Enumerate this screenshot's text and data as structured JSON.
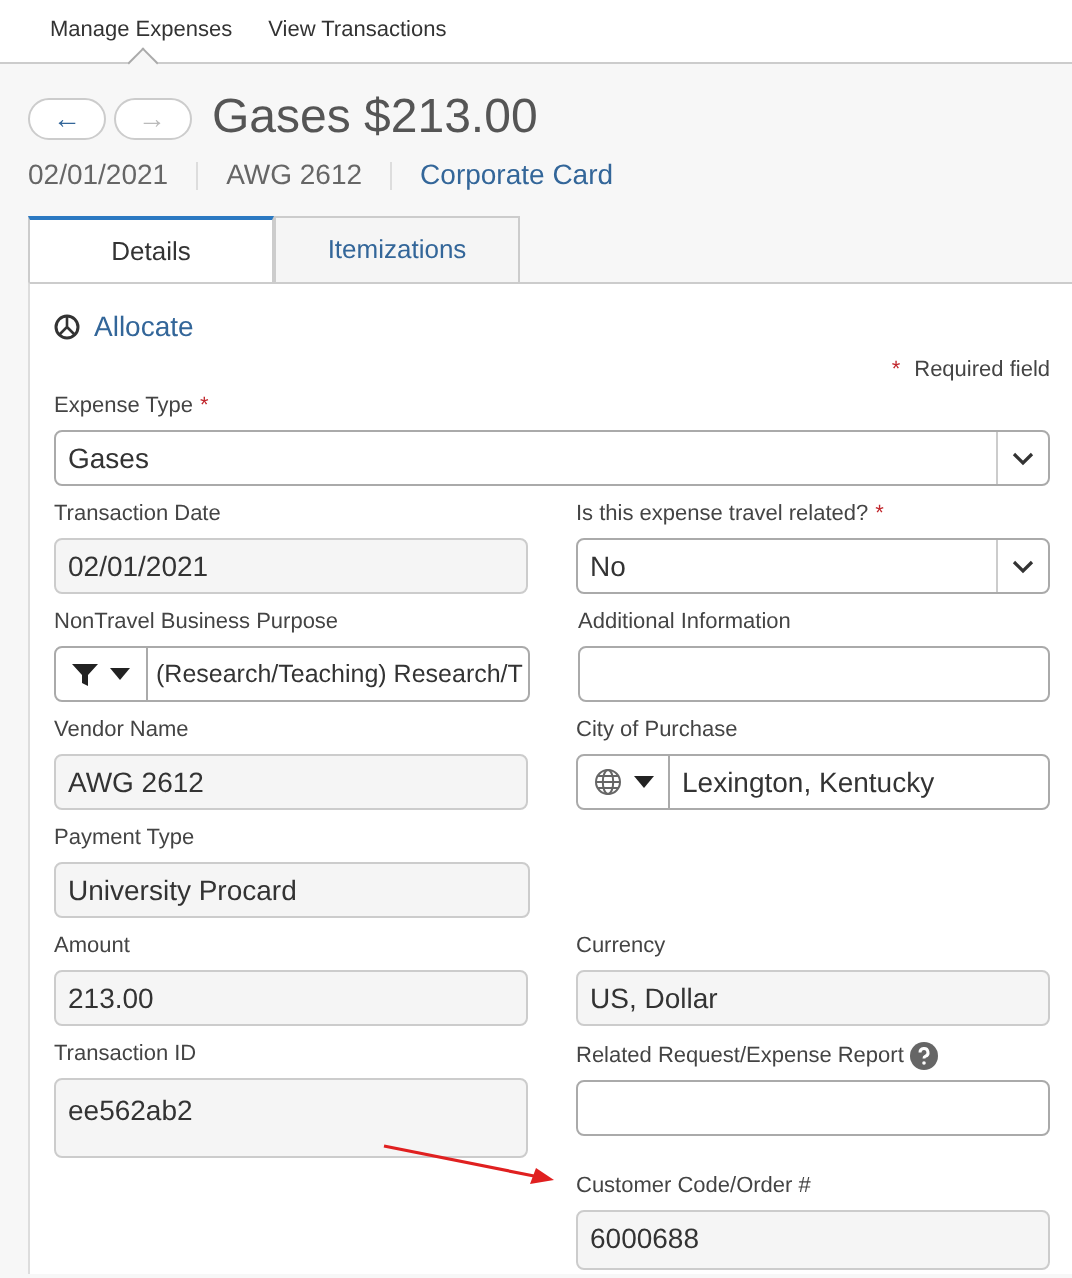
{
  "top_nav": [
    {
      "label": "Manage Expenses",
      "selected": true
    },
    {
      "label": "View Transactions",
      "selected": false
    }
  ],
  "header": {
    "prev": {
      "label": "←",
      "disabled": false
    },
    "next": {
      "label": "→",
      "disabled": true
    },
    "title": "Gases $213.00",
    "date": "02/01/2021",
    "vendor": "AWG 2612",
    "payment_link": "Corporate Card"
  },
  "tabs": [
    {
      "label": "Details",
      "selected": true
    },
    {
      "label": "Itemizations",
      "selected": false
    }
  ],
  "allocate_link": "Allocate",
  "required_note": {
    "mark": "*",
    "text": "Required field"
  },
  "rows": [
    {
      "fields": [
        {
          "kind": "select",
          "label": "Expense Type",
          "required": true,
          "value": "Gases",
          "readonly": false,
          "full": true
        }
      ]
    },
    {
      "fields": [
        {
          "kind": "text",
          "label": "Transaction Date",
          "required": false,
          "value": "02/01/2021",
          "readonly": true
        },
        {
          "kind": "select",
          "label": "Is this expense travel related?",
          "required": true,
          "value": "No",
          "readonly": false
        }
      ]
    },
    {
      "fields": [
        {
          "kind": "filter-combo",
          "label": "NonTravel Business Purpose",
          "required": false,
          "value": "(Research/Teaching) Research/T",
          "readonly": false
        },
        {
          "kind": "text",
          "label": "Additional Information",
          "required": false,
          "readonly": false
        }
      ]
    },
    {
      "fields": [
        {
          "kind": "text",
          "label": "Vendor Name",
          "required": false,
          "value": "AWG 2612",
          "readonly": true
        },
        {
          "kind": "location-combo",
          "label": "City of Purchase",
          "required": false,
          "value": "Lexington, Kentucky",
          "readonly": false
        }
      ]
    },
    {
      "fields": [
        {
          "kind": "text",
          "label": "Payment Type",
          "required": false,
          "value": "University Procard",
          "readonly": true
        }
      ]
    },
    {
      "fields": [
        {
          "kind": "text",
          "label": "Amount",
          "required": false,
          "value": "213.00",
          "readonly": true
        },
        {
          "kind": "text",
          "label": "Currency",
          "required": false,
          "value": "US, Dollar",
          "readonly": true
        }
      ]
    },
    {
      "fields": [
        {
          "kind": "textarea",
          "label": "Transaction ID",
          "required": false,
          "value": "ee562ab2",
          "readonly": true
        },
        {
          "kind": "text",
          "label": "Related Request/Expense Report",
          "required": false,
          "help": true,
          "readonly": false
        }
      ]
    },
    {
      "fields": [
        {
          "kind": "spacer"
        },
        {
          "kind": "textarea",
          "label": "Customer Code/Order #",
          "required": false,
          "value": "6000688",
          "readonly": true,
          "short": true
        }
      ]
    }
  ]
}
